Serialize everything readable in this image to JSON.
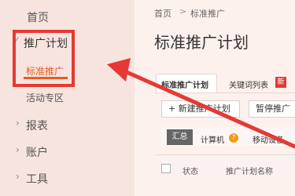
{
  "sidebar": {
    "home": "首页",
    "promo_plan": "推广计划",
    "standard_promo": "标准推广",
    "activity_zone": "活动专区",
    "reports": "报表",
    "account": "账户",
    "tools": "工具"
  },
  "breadcrumb": {
    "home": "首页",
    "separator": ">",
    "current": "标准推广"
  },
  "page_title": "标准推广计划",
  "tabs": [
    {
      "label": "标准推广计划"
    },
    {
      "label": "关键词列表",
      "badge": "新"
    }
  ],
  "toolbar": {
    "new_plan": "+ 新建推广计划",
    "pause": "暂停推广"
  },
  "filters": {
    "summary": "汇总",
    "computer": "计算机",
    "mobile": "移动设备",
    "info_icon": "?"
  },
  "table": {
    "status_header": "状态",
    "name_header": "推广计划名称"
  },
  "annotation_color": "#e53935"
}
